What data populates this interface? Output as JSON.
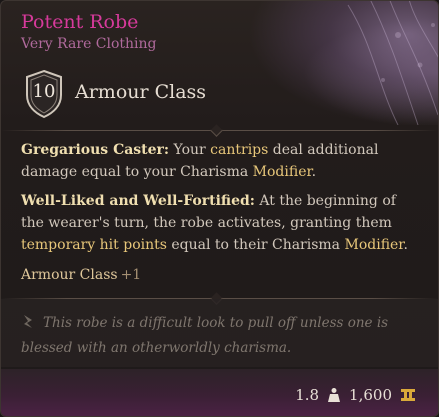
{
  "item": {
    "name": "Potent Robe",
    "rarity": "Very Rare Clothing",
    "rarity_color": "#b06a9c",
    "name_color": "#d63a9b"
  },
  "armour": {
    "value": "10",
    "label": "Armour Class",
    "icon": "shield-icon"
  },
  "passives": [
    {
      "name": "Gregarious Caster:",
      "text_parts": [
        "Your ",
        "cantrips",
        " deal additional damage equal to your Charisma ",
        "Modifier",
        "."
      ]
    },
    {
      "name": "Well-Liked and Well-Fortified:",
      "text_parts": [
        "At the beginning of the wearer's turn, the robe activates, granting them ",
        "temporary hit points",
        " equal to their Charisma ",
        "Modifier",
        "."
      ]
    }
  ],
  "bonus": {
    "label": "Armour Class",
    "value": "+1"
  },
  "flavor": {
    "icon": "quill-icon",
    "text": "This robe is a difficult look to pull off unless one is blessed with an otherworldly charisma."
  },
  "footer": {
    "weight": "1.8",
    "weight_icon": "weight-icon",
    "price": "1,600",
    "price_icon": "gold-coin-icon"
  },
  "colors": {
    "keyword": "#e8c77a",
    "passive_name": "#f0dfb0",
    "footer_bg": "#3a2034"
  }
}
